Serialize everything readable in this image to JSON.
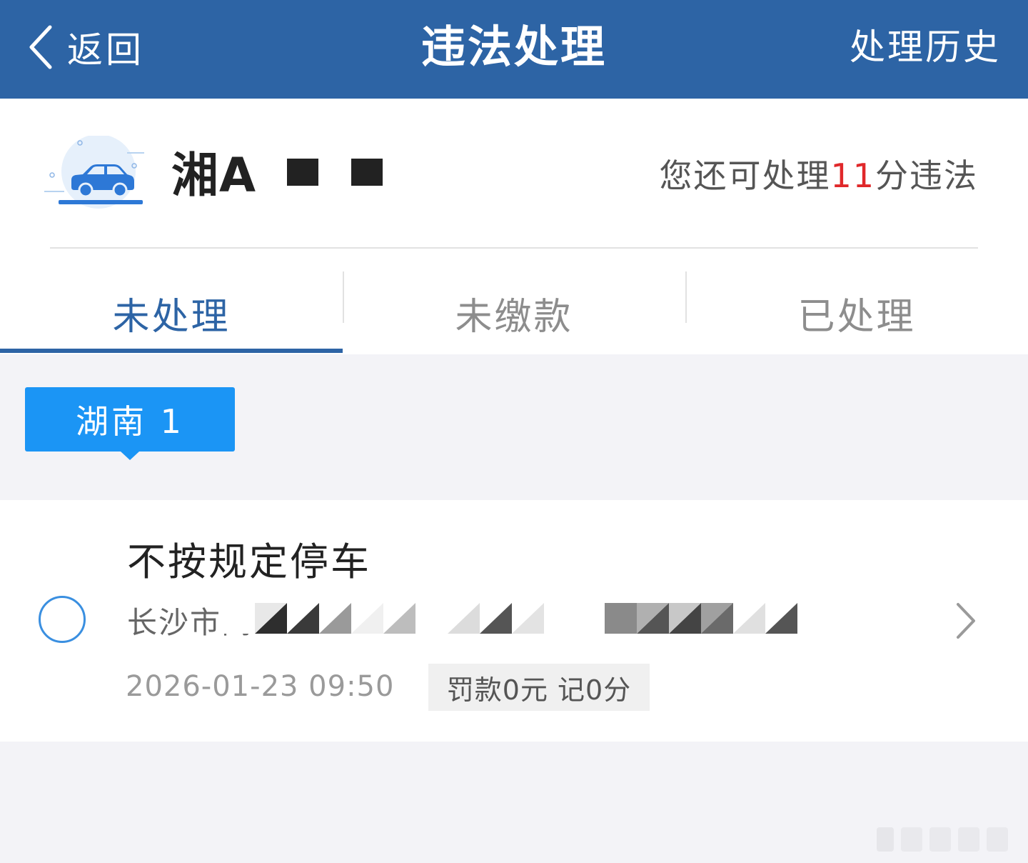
{
  "header": {
    "back_label": "返回",
    "title": "违法处理",
    "history_label": "处理历史"
  },
  "vehicle": {
    "plate_prefix": "湘A",
    "points_prefix": "您还可处理",
    "points_value": "11",
    "points_suffix": "分违法"
  },
  "tabs": [
    {
      "label": "未处理",
      "active": true
    },
    {
      "label": "未缴款",
      "active": false
    },
    {
      "label": "已处理",
      "active": false
    }
  ],
  "region_tag": "湖南 1",
  "violation": {
    "title": "不按规定停车",
    "location_visible": "长沙市高",
    "datetime": "2026-01-23 09:50",
    "penalty": "罚款0元 记0分"
  },
  "colors": {
    "header_bg": "#2d64a5",
    "accent_blue": "#1b95f5",
    "points_red": "#e0282a",
    "page_bg": "#f3f3f7"
  },
  "icons": {
    "back": "chevron-left-icon",
    "car": "car-icon",
    "row_arrow": "chevron-right-icon",
    "select": "radio-circle-icon"
  }
}
